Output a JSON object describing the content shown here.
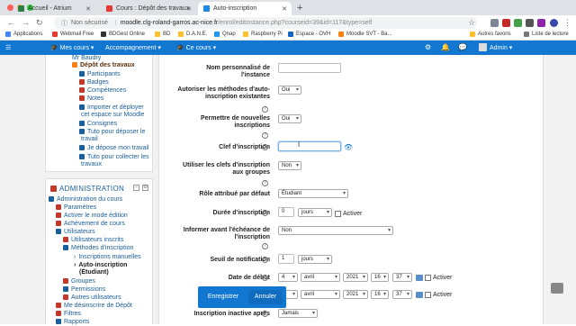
{
  "browser": {
    "tabs": [
      {
        "label": "Accueil - Atrium",
        "color": "#2d7d46"
      },
      {
        "label": "Cours : Dépôt des travaux",
        "color": "#e53935"
      },
      {
        "label": "Auto-inscription",
        "color": "#1e88e5"
      }
    ],
    "new_tab": "+",
    "security": "Non sécurisé",
    "url_host": "moodle.clg-roland-garros.ac-nice.fr",
    "url_path": "/enrol/editinstance.php?courseid=39&id=117&type=self",
    "bookmarks": [
      {
        "label": "Applications",
        "color": "#4285f4"
      },
      {
        "label": "Webmail Free",
        "color": "#e53935"
      },
      {
        "label": "BDGest Online",
        "color": "#333333"
      },
      {
        "label": "BD",
        "color": "#555555"
      },
      {
        "label": "D.A.N.E.",
        "color": "#555555"
      },
      {
        "label": "Qnap",
        "color": "#2196f3"
      },
      {
        "label": "Raspberry Pi",
        "color": "#c51a4a"
      },
      {
        "label": "Espace - OVH",
        "color": "#1565c0"
      },
      {
        "label": "Moodle SVT - Ba...",
        "color": "#f98012"
      },
      {
        "label": "Autres favoris",
        "color": "#555555"
      },
      {
        "label": "Liste de lecture",
        "color": "#555555"
      }
    ]
  },
  "navbar": {
    "mes_cours": "Mes cours",
    "accompagnement": "Accompagnement",
    "ce_cours": "Ce cours",
    "user": "Admin"
  },
  "course_nav": {
    "items": [
      {
        "label": "Mr Baudry",
        "style": "link"
      },
      {
        "label": "Dépôt des travaux",
        "style": "bold"
      },
      {
        "label": "Participants",
        "style": "link"
      },
      {
        "label": "Badges",
        "style": "link"
      },
      {
        "label": "Compétences",
        "style": "link"
      },
      {
        "label": "Notes",
        "style": "link"
      },
      {
        "label": "Importer et déployer",
        "style": "link"
      },
      {
        "label": "cet espace sur Moodle",
        "style": "link"
      },
      {
        "label": "Consignes",
        "style": "link"
      },
      {
        "label": "Tuto pour déposer le",
        "style": "link"
      },
      {
        "label": "travail",
        "style": "link"
      },
      {
        "label": "Je dépose mon travail",
        "style": "link"
      },
      {
        "label": "Tuto pour collecter les",
        "style": "link"
      },
      {
        "label": "travaux",
        "style": "link"
      }
    ]
  },
  "admin": {
    "title": "ADMINISTRATION",
    "items": [
      {
        "label": "Administration du cours"
      },
      {
        "label": "Paramètres"
      },
      {
        "label": "Activer le mode édition"
      },
      {
        "label": "Achèvement de cours"
      },
      {
        "label": "Utilisateurs"
      },
      {
        "label": "Utilisateurs inscrits"
      },
      {
        "label": "Méthodes d'inscription"
      },
      {
        "label": "Inscriptions manuelles"
      },
      {
        "label": "Auto-inscription"
      },
      {
        "label": "(Étudiant)"
      },
      {
        "label": "Groupes"
      },
      {
        "label": "Permissions"
      },
      {
        "label": "Autres utilisateurs"
      },
      {
        "label": "Me désinscrire de Dépôt"
      },
      {
        "label": "Filtres"
      },
      {
        "label": "Rapports"
      }
    ]
  },
  "form": {
    "nom_label_1": "Nom personnalisé de",
    "nom_label_2": "l'instance",
    "nom_value": "",
    "autoriser_label_1": "Autoriser les méthodes d'auto-",
    "autoriser_label_2": "inscription existantes",
    "autoriser_value": "Oui",
    "permettre_label_1": "Permettre de nouvelles",
    "permettre_label_2": "inscriptions",
    "permettre_value": "Oui",
    "clef_label": "Clef d'inscription",
    "clef_value": "",
    "clefs_groupes_label_1": "Utiliser les clefs d'inscription",
    "clefs_groupes_label_2": "aux groupes",
    "clefs_groupes_value": "Non",
    "role_label": "Rôle attribué par défaut",
    "role_value": "Étudiant",
    "duree_label": "Durée d'inscription",
    "duree_value": "0",
    "duree_unit": "jours",
    "duree_activer": "Activer",
    "informer_label_1": "Informer avant l'échéance de",
    "informer_label_2": "l'inscription",
    "informer_value": "Non",
    "seuil_label": "Seuil de notification",
    "seuil_value": "1",
    "seuil_unit": "jours",
    "debut_label": "Date de début",
    "debut_day": "4",
    "debut_month": "avril",
    "debut_year": "2021",
    "debut_hour": "16",
    "debut_min": "37",
    "debut_activer": "Activer",
    "fin_month": "avril",
    "fin_year": "2021",
    "fin_hour": "16",
    "fin_min": "37",
    "fin_activer": "Activer",
    "inactive_label": "Inscription inactive après",
    "inactive_value": "Jamais",
    "save_button": "Enregistrer",
    "cancel_button": "Annuler"
  },
  "colors": {
    "brand": "#1177d1",
    "link": "#1a5e9a"
  }
}
